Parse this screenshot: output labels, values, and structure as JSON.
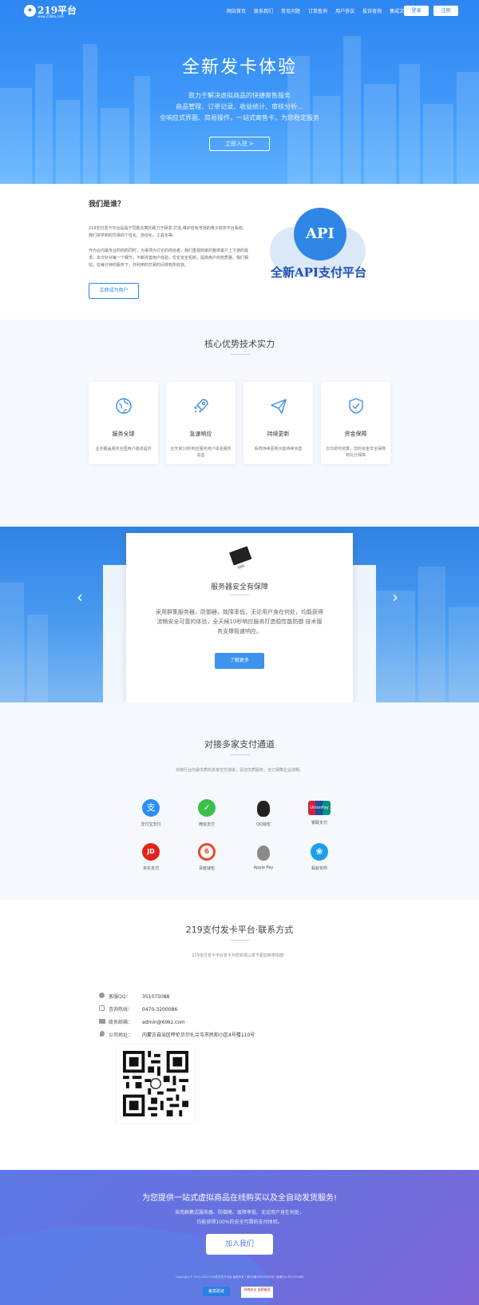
{
  "nav": {
    "logo_text": "219平台",
    "logo_sub": "www.219ka.com",
    "items": [
      "网站首页",
      "联系我们",
      "常见问题",
      "订单查询",
      "用户协议",
      "投诉查询",
      "集成文档"
    ],
    "login": "登录",
    "register": "注册"
  },
  "hero": {
    "title": "全新发卡体验",
    "lines": [
      "致力于解决虚拟商品的快捷寄售服务",
      "商品管理、订单记录、收益统计、审核分析...",
      "全响应式界面、简易操作，一站式寄售卡，为您稳定服务"
    ],
    "button": "立即入驻 >"
  },
  "about": {
    "title": "我们是谁？",
    "p1": "219支付发卡平台是属于同胜云寓托致力于研发,打造,维护自有市场的电子商务平台系统。我们将学到的交易的个性化、自动化、工具化等。",
    "p2": "作为业内最专业的商的同时，为事项为讨论的商信者。我们重视商家的整体客户上下游的需求。本次针对每一个细节，不断完善用户体验，优化安全机制，提高用户商务质量。我们相信，在每分钟的服务下，并利用的交易时间将有所收获。",
    "button": "立即成为商户",
    "api_badge": "API",
    "api_caption": "全新API支付平台"
  },
  "features": {
    "title": "核心优势技术实力",
    "cards": [
      {
        "icon": "globe-icon",
        "title": "服务全球",
        "desc": "业务覆盖服务全国用户描述提供"
      },
      {
        "icon": "rocket-icon",
        "title": "急速响应",
        "desc": "全天候10秒响应服务用户体验服务完善"
      },
      {
        "icon": "paper-plane-icon",
        "title": "持续更新",
        "desc": "系统持续更新功能持续完善"
      },
      {
        "icon": "shield-icon",
        "title": "资金保障",
        "desc": "次日即可结算，您的资金安全保障到充分保障"
      }
    ]
  },
  "slider": {
    "title": "服务器安全有保障",
    "text": "采用群集服务器，防御器，故障率低，无论用户身在何处，均能获得流畅安全可靠的体验，全天候10秒响应服务打造稳性能防御 技术服务支撑极速响应。",
    "button": "了解更多",
    "prev": "‹",
    "next": "›"
  },
  "payments": {
    "title": "对接多家支付通道",
    "subtitle": "对接行业内最优质的多家支付通道，清洁优质服务，全力保障企业流畅。",
    "items": [
      {
        "label": "支付宝支付",
        "icon": "alipay-icon",
        "color": "#2a8ff7"
      },
      {
        "label": "微信支付",
        "icon": "wechat-icon",
        "color": "#3bbf46"
      },
      {
        "label": "QQ钱包",
        "icon": "qq-icon",
        "color": "#222222"
      },
      {
        "label": "银联支付",
        "icon": "unionpay-icon",
        "color": "#d4213d"
      },
      {
        "label": "京东支付",
        "icon": "jd-icon",
        "color": "#e1251b"
      },
      {
        "label": "百度钱包",
        "icon": "baidu-wallet-icon",
        "color": "#e54a2b"
      },
      {
        "label": "Apple Pay",
        "icon": "apple-icon",
        "color": "#8a8a8a"
      },
      {
        "label": "蚂蚁花呗",
        "icon": "huabei-icon",
        "color": "#1a9fe8"
      }
    ]
  },
  "contact": {
    "title": "219支付发卡平台·联系方式",
    "subtitle": "219支付发卡平台发卡为您实现以发卡更加简单快捷！",
    "rows": [
      {
        "icon": "qq-small-icon",
        "key": "客服QQ：",
        "value": "351075088"
      },
      {
        "icon": "phone-icon",
        "key": "咨询热线：",
        "value": "0470-3200086"
      },
      {
        "icon": "mail-icon",
        "key": "联系邮箱：",
        "value": "admin@69kz.com"
      },
      {
        "icon": "location-icon",
        "key": "公司地址：",
        "value": "内蒙古自治区呼伦贝尔扎兰屯市民和小区4号楼110号"
      }
    ]
  },
  "cta": {
    "title": "为您提供一站式虚拟商品在线购买以及全自动发货服务!",
    "line1": "采用群集式服务器、防御高、故障率低、无论用户身在何处，",
    "line2": "均能获得100%的安全可靠的支付体验。",
    "button": "加入我们",
    "copyright": "Copyright © 2015-2022 219支付发卡平台 版权所有 | 蒙ICP备00000000号 | 客服QQ:351075088",
    "badge1": "备案验证",
    "badge2": "网络安全 监察备案"
  }
}
